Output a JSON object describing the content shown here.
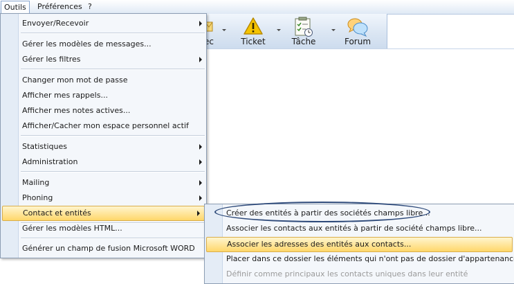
{
  "menubar": {
    "outils": "Outils",
    "preferences": "Préférences",
    "help": "?"
  },
  "toolbar": {
    "partial_label": "ec",
    "ticket": "Ticket",
    "tache": "Tâche",
    "forum": "Forum"
  },
  "outils_menu": {
    "envoyer_recevoir": "Envoyer/Recevoir",
    "gerer_modeles_messages": "Gérer les modèles de messages...",
    "gerer_filtres": "Gérer les filtres",
    "changer_mot_de_passe": "Changer mon mot de passe",
    "afficher_rappels": "Afficher mes rappels...",
    "afficher_notes": "Afficher mes notes actives...",
    "afficher_espace": "Afficher/Cacher mon espace personnel actif",
    "statistiques": "Statistiques",
    "administration": "Administration",
    "mailing": "Mailing",
    "phoning": "Phoning",
    "contact_entites": "Contact et entités",
    "gerer_modeles_html": "Gérer les modèles HTML...",
    "generer_champ_fusion": "Générer un champ de fusion Microsoft WORD"
  },
  "contact_submenu": {
    "creer_entites": "Créer des entités à partir des sociétés champs libre...",
    "associer_contacts": "Associer les contacts aux entités à partir de société champs libre...",
    "associer_adresses": "Associer les adresses des entités aux contacts...",
    "placer_dossier": "Placer dans ce dossier les éléments qui n'ont pas de dossier d'appartenance",
    "definir_principaux": "Définir comme principaux les contacts uniques dans leur entité"
  },
  "colors": {
    "highlight_top": "#fff5cf",
    "highlight_bottom": "#ffd76a",
    "annotation_oval": "#2e4a7a"
  }
}
